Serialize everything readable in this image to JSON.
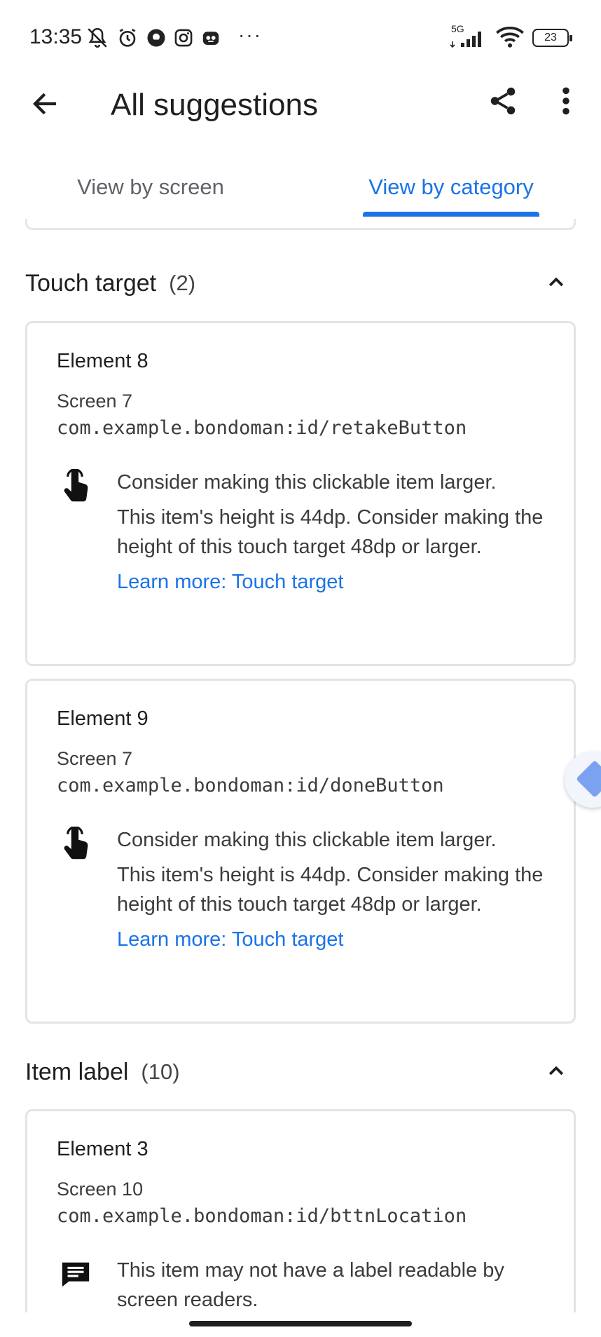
{
  "status_bar": {
    "time": "13:35",
    "network": "5G",
    "battery": "23",
    "overflow": "···",
    "icons": [
      "mute-icon",
      "alarm-icon",
      "vpn-icon",
      "instagram-icon",
      "app-icon",
      "signal-icon",
      "wifi-icon",
      "battery-icon"
    ]
  },
  "header": {
    "title": "All suggestions",
    "back_icon": "arrow-back-icon",
    "share_icon": "share-icon",
    "more_icon": "more-vert-icon"
  },
  "tabs": [
    {
      "label": "View by screen",
      "selected": false
    },
    {
      "label": "View by category",
      "selected": true
    }
  ],
  "colors": {
    "accent": "#1a73e8",
    "text": "#1f1f1f",
    "secondary": "#5f6368",
    "card_border": "#e4e4e4"
  },
  "sections": [
    {
      "title": "Touch target",
      "count": "(2)",
      "expanded": true,
      "cards": [
        {
          "title": "Element 8",
          "screen": "Screen 7",
          "id": "com.example.bondoman:id/retakeButton",
          "icon": "touch-icon",
          "line1": "Consider making this clickable item larger.",
          "detail": "This item's height is 44dp. Consider making the height of this touch target 48dp or larger.",
          "link": "Learn more: Touch target"
        },
        {
          "title": "Element 9",
          "screen": "Screen 7",
          "id": "com.example.bondoman:id/doneButton",
          "icon": "touch-icon",
          "line1": "Consider making this clickable item larger.",
          "detail": "This item's height is 44dp. Consider making the height of this touch target 48dp or larger.",
          "link": "Learn more: Touch target"
        }
      ]
    },
    {
      "title": "Item label",
      "count": "(10)",
      "expanded": true,
      "cards": [
        {
          "title": "Element 3",
          "screen": "Screen 10",
          "id": "com.example.bondoman:id/bttnLocation",
          "icon": "comment-icon",
          "line1": "This item may not have a label readable by screen readers."
        }
      ]
    }
  ]
}
